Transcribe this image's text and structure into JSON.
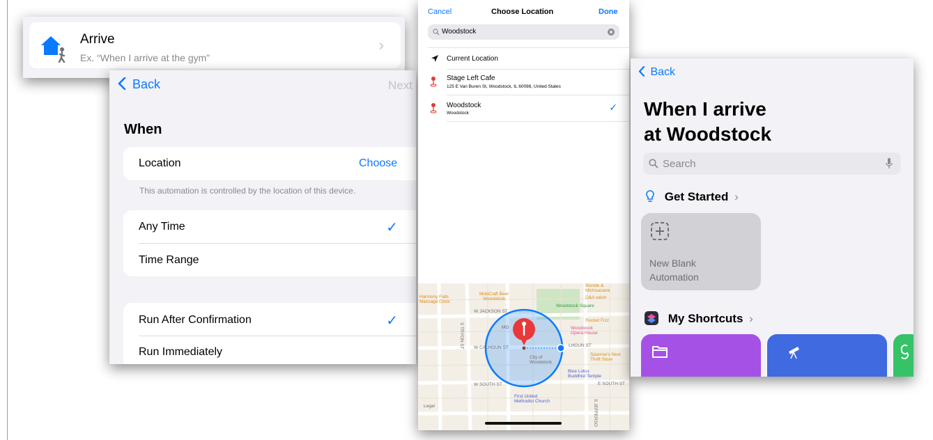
{
  "arrive": {
    "title": "Arrive",
    "subtitle": "Ex. “When I arrive at the gym”",
    "icon": "house-walk-icon",
    "chevron": "›"
  },
  "when": {
    "back": "Back",
    "next": "Next",
    "heading": "When",
    "location_label": "Location",
    "location_action": "Choose",
    "location_note": "This automation is controlled by the location of this device.",
    "time_options": [
      "Any Time",
      "Time Range"
    ],
    "time_selected": "Any Time",
    "run_options": [
      "Run After Confirmation",
      "Run Immediately"
    ],
    "run_selected": "Run After Confirmation",
    "accent": "#0a7aff"
  },
  "choose": {
    "cancel": "Cancel",
    "title": "Choose Location",
    "done": "Done",
    "search_value": "Woodstock",
    "current_location": "Current Location",
    "results": [
      {
        "name": "Stage Left Cafe",
        "address": "125 E Van Buren St, Woodstock, IL  60098, United States",
        "selected": false
      },
      {
        "name": "Woodstock",
        "address": "Woodstock",
        "selected": true
      }
    ],
    "map_labels": {
      "harmony": "Harmony Falls\nMassage Clinic",
      "mobcraft": "MobCraft Beer\nWoodstock",
      "blonde": "Blonde &\nMichoacana",
      "da_salon": "D&A salon",
      "square": "Woodstock Square",
      "rocket": "Rocket Fizz",
      "opera": "Woodstock\nOpera House",
      "sparrow": "Sparrow's Nest\nThrift Store",
      "city": "City of\nWoodstock",
      "blue_lotus": "Blue Lotus\nBuddhist Temple",
      "methodist": "First United\nMethodist Church",
      "mo": "MO",
      "jackson": "W JACKSON ST",
      "calhoun": "W CALHOUN ST",
      "calhoun_e": "LHOUN ST",
      "south": "W SOUTH ST",
      "south_e": "E SOUTH ST",
      "tryon": "S TRYON ST",
      "jefferson": "S JEFFERSO",
      "legal": "Legal"
    }
  },
  "shortcuts": {
    "back": "Back",
    "title_line1": "When I arrive",
    "title_line2": "at Woodstock",
    "search_placeholder": "Search",
    "get_started": "Get Started",
    "new_blank_line1": "New Blank",
    "new_blank_line2": "Automation",
    "my_shortcuts": "My Shortcuts",
    "tile_colors": [
      "#a551e6",
      "#3f6ae0",
      "#36c267"
    ]
  }
}
